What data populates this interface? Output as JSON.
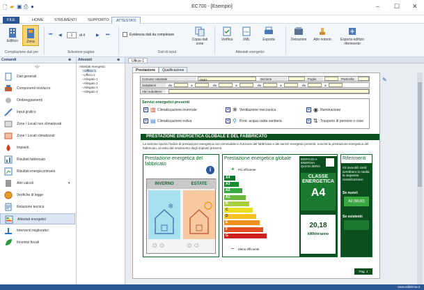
{
  "window": {
    "title": "EC700 - [Esempio]"
  },
  "menu": {
    "items": [
      "FILE",
      "HOME",
      "STRUMENTI",
      "SUPPORTO",
      "ATTESTATI"
    ]
  },
  "ribbon": {
    "edificio": "Edificio",
    "zona": "Zona",
    "group1": "Compilazione dati per",
    "page_value": "1",
    "page_of": "di 4",
    "group2": "Selezione pagina",
    "evidenzia": "Evidenzia dati da completare",
    "copia": "Copia dati zone",
    "group3": "Dati di input",
    "verifica": "Verifica",
    "xml": "XML",
    "esporta": "Esporta",
    "group4": "Attestati energetici",
    "detrazioni": "Detrazioni",
    "atto": "Atto notorio",
    "esporta_edificio": "Esporta edificio riferimento"
  },
  "left": {
    "header": "Comandi",
    "items": [
      "Dati generali",
      "Componenti involucro",
      "Ombreggiamenti",
      "Input grafico",
      "Zone / Locali non climatizzati",
      "Zone / Locali climatizzati",
      "Impianti",
      "Risultati fabbricato",
      "Risultati energia primaria",
      "Altri calcoli",
      "Verifiche di legge",
      "Relazione tecnica",
      "Attestati energetici",
      "Interventi migliorativi",
      "Incentivi fiscali"
    ]
  },
  "tree": {
    "header": "Attestati",
    "root": "Attestati energetici",
    "nodes": [
      "Ufficio 1",
      "Ufficio 2",
      "Allegato 1",
      "Allegato 2",
      "Allegato 3",
      "Allegato 4"
    ]
  },
  "main": {
    "doc_tab": "Ufficio 1",
    "tabs": [
      "Prestazione",
      "Qualificazione"
    ]
  },
  "doc": {
    "comune_label": "Comune catastale",
    "comune_value": "H501",
    "sezione": "Sezione",
    "foglio": "Foglio",
    "particella": "Particella",
    "subalterni": "Subalterni",
    "altri": "Altri subalterni",
    "da": "da",
    "a": "a",
    "servizi_title": "Servizi energetici presenti",
    "servizi": [
      "Climatizzazione invernale",
      "Ventilazione meccanica",
      "Illuminazione",
      "Climatizzazione estiva",
      "Prod. acqua calda sanitaria",
      "Trasporto di persone o cose"
    ],
    "banner": "PRESTAZIONE ENERGETICA GLOBALE E DEL FABBRICATO",
    "para": "La sezione riporta l'indice di prestazione energetica non rinnovabile in funzione del fabbricato e dei servizi energetici presenti, nonché la prestazione energetica del fabbricato, al netto del rendimento degli impianti presenti.",
    "box1_title": "Prestazione energetica del fabbricato",
    "inverno": "INVERNO",
    "estate": "ESTATE",
    "box2_title": "Prestazione energetica globale",
    "piu": "Più efficiente",
    "meno": "Meno efficiente",
    "classes": [
      "A4",
      "A3",
      "A2",
      "A1",
      "B",
      "C",
      "D",
      "E",
      "F",
      "G"
    ],
    "nzeb": "EDIFICIO A ENERGIA QUASI ZERO",
    "classe_label": "CLASSE ENERGETICA",
    "classe_value": "A4",
    "indice_value": "20,18",
    "indice_unit": "kWh/m²anno",
    "box3_title": "Riferimenti",
    "rif_text": "Gli immobili simili avrebbero in media la seguente classificazione:",
    "se_nuovi": "Se nuovi:",
    "se_nuovi_val": "A2 (58,00)",
    "se_esistenti": "Se esistenti:",
    "page": "Pag. 1"
  },
  "status": {
    "text": "www.edilclima.it"
  },
  "colors": {
    "accent": "#2b5797",
    "banner": "#0b4f1f"
  }
}
